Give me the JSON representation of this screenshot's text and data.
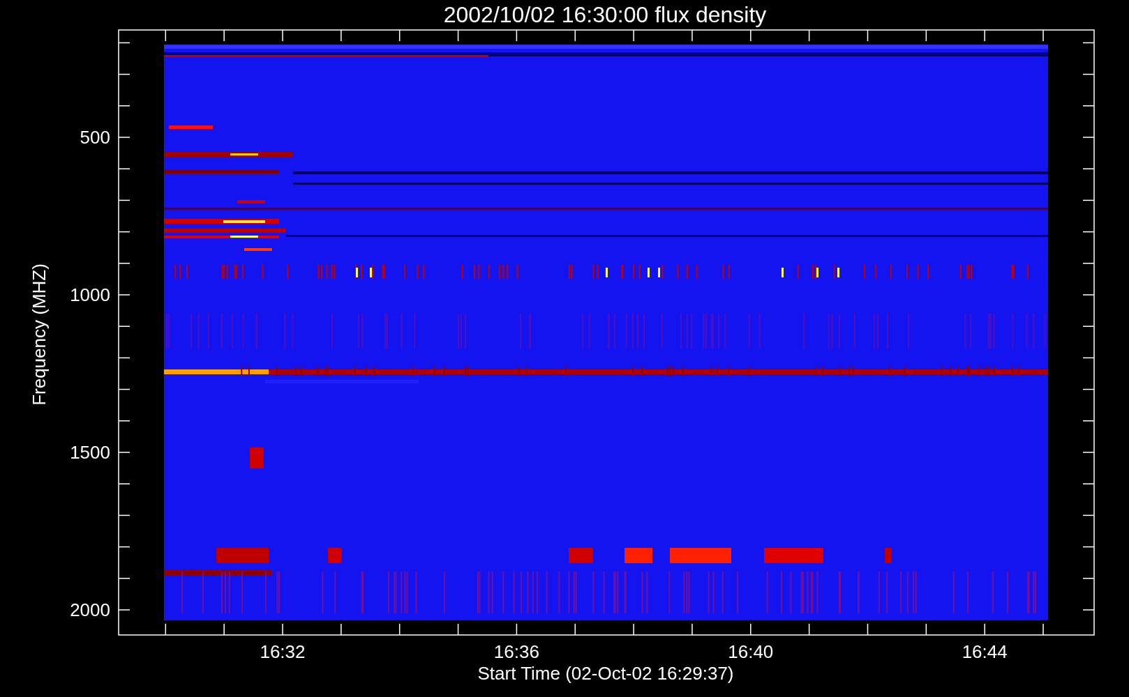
{
  "plot": {
    "title": "2002/10/02 16:30:00 flux density",
    "y_axis": {
      "label": "Frequency (MHZ)",
      "ticks": [
        "500",
        "1000",
        "1500",
        "2000"
      ]
    },
    "x_axis": {
      "label": "Start Time (02-Oct-02 16:29:37)",
      "ticks": [
        "16:32",
        "16:36",
        "16:40",
        "16:44"
      ]
    }
  }
}
